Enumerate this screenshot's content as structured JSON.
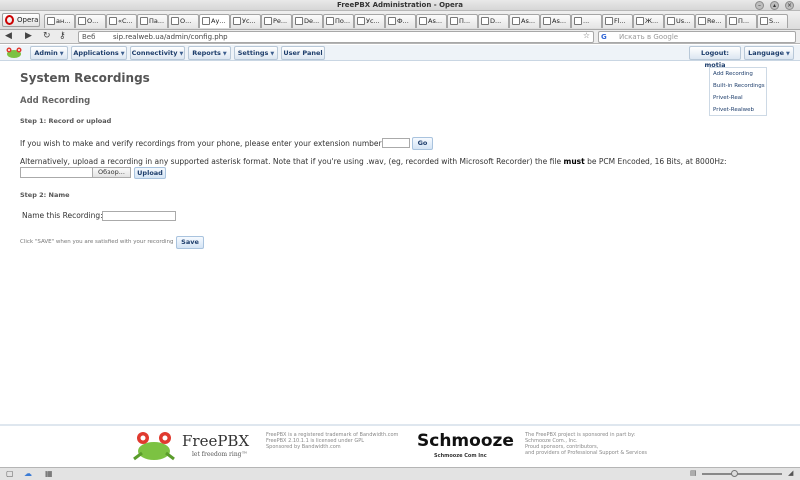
{
  "window": {
    "title": "FreePBX Administration - Opera"
  },
  "browser": {
    "menu_label": "Opera",
    "tabs": [
      {
        "label": "ан..."
      },
      {
        "label": "О..."
      },
      {
        "label": "«С..."
      },
      {
        "label": "Па..."
      },
      {
        "label": "О..."
      },
      {
        "label": "Ау..."
      },
      {
        "label": "Ус..."
      },
      {
        "label": "Ре..."
      },
      {
        "label": "De..."
      },
      {
        "label": "По..."
      },
      {
        "label": "Ус..."
      },
      {
        "label": "Ф..."
      },
      {
        "label": "As..."
      },
      {
        "label": "П..."
      },
      {
        "label": "D..."
      },
      {
        "label": "As..."
      },
      {
        "label": "As..."
      },
      {
        "label": "..."
      },
      {
        "label": "Fl..."
      },
      {
        "label": "Ж..."
      },
      {
        "label": "Us..."
      },
      {
        "label": "Re..."
      },
      {
        "label": "П..."
      },
      {
        "label": "S..."
      }
    ],
    "address": {
      "scheme_label": "Веб",
      "url": "sip.realweb.ua/admin/config.php"
    },
    "search": {
      "engine": "G",
      "placeholder": "Искать в Google"
    }
  },
  "menubar": {
    "items": [
      {
        "label": "Admin",
        "dropdown": true
      },
      {
        "label": "Applications",
        "dropdown": true
      },
      {
        "label": "Connectivity",
        "dropdown": true
      },
      {
        "label": "Reports",
        "dropdown": true
      },
      {
        "label": "Settings",
        "dropdown": true
      },
      {
        "label": "User Panel",
        "dropdown": false
      }
    ],
    "logout_label": "Logout: motja",
    "language_label": "Language"
  },
  "page": {
    "title": "System Recordings",
    "subtitle": "Add Recording",
    "step1": {
      "heading": "Step 1: Record or upload",
      "phone_text": "If you wish to make and verify recordings from your phone, please enter your extension number here:",
      "extension_value": "",
      "go_label": "Go",
      "upload_text_pre": "Alternatively, upload a recording in any supported asterisk format. Note that if you're using .wav, (eg, recorded with Microsoft Recorder) the file",
      "upload_text_bold": "must",
      "upload_text_post": "be PCM Encoded, 16 Bits, at 8000Hz:",
      "browse_label": "Обзор...",
      "upload_label": "Upload"
    },
    "step2": {
      "heading": "Step 2: Name",
      "name_label": "Name this Recording:",
      "name_value": "",
      "save_hint": "Click \"SAVE\" when you are satisfied with your recording",
      "save_label": "Save"
    }
  },
  "rightnav": {
    "items": [
      {
        "label": "Add Recording"
      },
      {
        "label": "Built-in Recordings"
      },
      {
        "label": "Privet-Real"
      },
      {
        "label": "Privet-Realweb"
      }
    ]
  },
  "footer": {
    "freepbx_name": "FreePBX",
    "freepbx_tagline": "let freedom ring™",
    "freepbx_lines": [
      "FreePBX is a registered trademark of Bandwidth.com",
      "FreePBX 2.10.1.1 is licensed under GPL",
      "Sponsored by Bandwidth.com"
    ],
    "schmooze_name": "Schmooze",
    "schmooze_sub": "Schmooze Com Inc",
    "sponsor_lines": [
      "The FreePBX project is sponsored in part by:",
      "Schmooze Com., Inc.",
      "Proud sponsors, contributors,",
      "and providers of Professional Support & Services"
    ]
  },
  "colors": {
    "accent": "#1d3d6b",
    "menubar_bg": "#eef3f8",
    "button_bg": "#d4e4f5",
    "opera_red": "#cc0000"
  }
}
